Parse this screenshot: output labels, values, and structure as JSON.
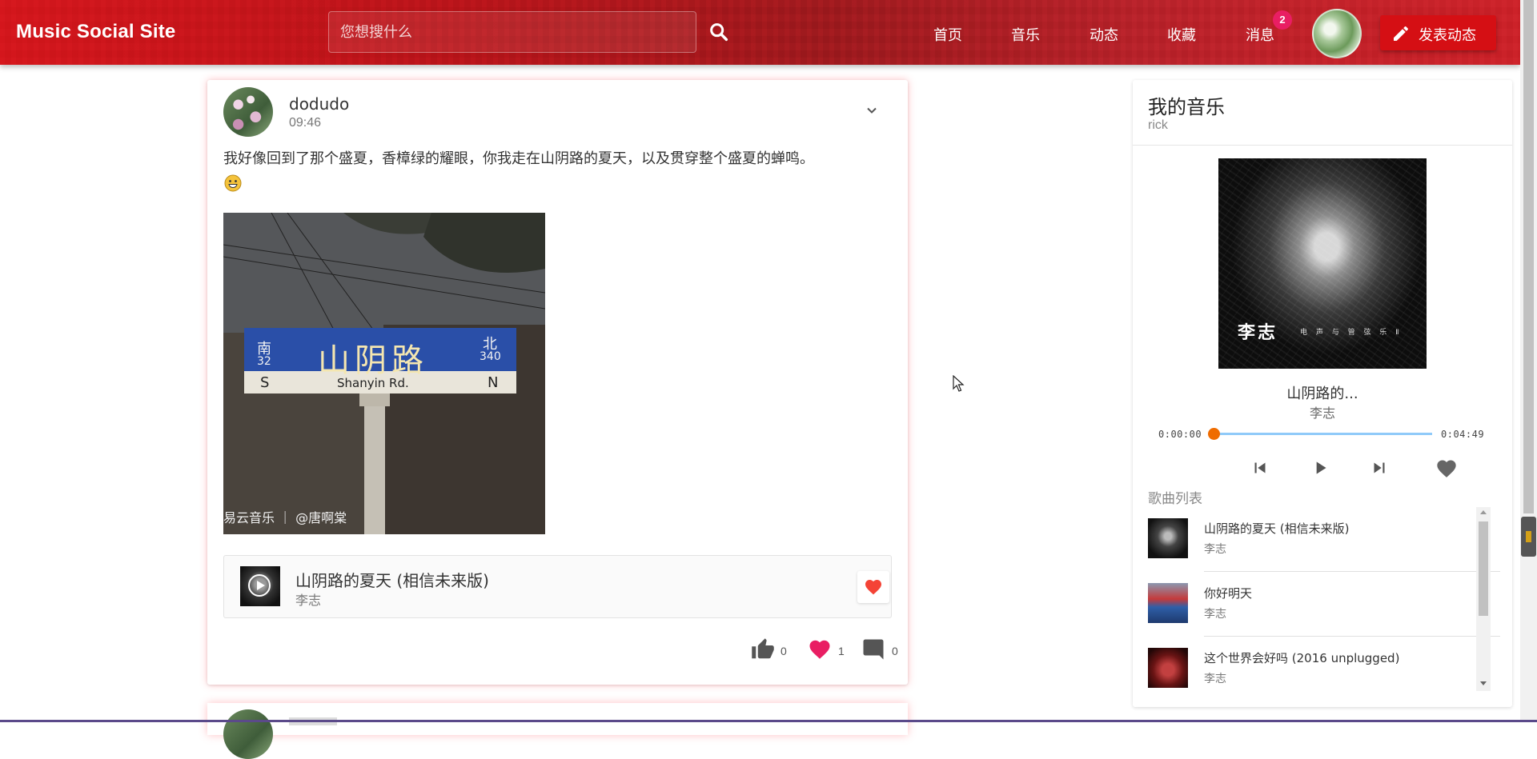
{
  "header": {
    "brand": "Music Social Site",
    "search_placeholder": "您想搜什么",
    "nav": [
      {
        "label": "首页"
      },
      {
        "label": "音乐"
      },
      {
        "label": "动态"
      },
      {
        "label": "收藏"
      },
      {
        "label": "消息"
      }
    ],
    "message_badge": "2",
    "publish_label": "发表动态",
    "icons": {
      "search": "search-icon",
      "publish": "pencil-icon"
    }
  },
  "post": {
    "username": "dodudo",
    "time": "09:46",
    "text": "我好像回到了那个盛夏，香樟绿的耀眼，你我走在山阴路的夏天，以及贯穿整个盛夏的蝉鸣。",
    "emoji": "grinning-face-emoji",
    "image": {
      "sign_left": "南",
      "sign_left_num": "32",
      "sign_main": "山阴路",
      "sign_right": "北",
      "sign_right_num": "340",
      "sign_s": "S",
      "sign_road": "Shanyin Rd.",
      "sign_n": "N",
      "watermark": "易云音乐 ｜ @唐啊棠"
    },
    "song": {
      "title": "山阴路的夏天 (相信未来版)",
      "artist": "李志",
      "favorited": true
    },
    "stats": {
      "likes": "0",
      "hearts": "1",
      "comments": "0"
    },
    "accent_color": "#f44336",
    "heart_color": "#e91e63"
  },
  "music": {
    "title": "我的音乐",
    "user": "rick",
    "cover": {
      "artist_text": "李志",
      "sub_text": "电 声 与 管 弦 乐 Ⅱ"
    },
    "now_playing": {
      "title": "山阴路的...",
      "artist": "李志",
      "current_time": "0:00:00",
      "total_time": "0:04:49",
      "progress": 0
    },
    "list_label": "歌曲列表",
    "songs": [
      {
        "title": "山阴路的夏天 (相信未来版)",
        "artist": "李志"
      },
      {
        "title": "你好明天",
        "artist": "李志"
      },
      {
        "title": "这个世界会好吗 (2016 unplugged)",
        "artist": "李志"
      }
    ],
    "progress_color": "#ef6c00",
    "track_color": "#90caf9"
  }
}
